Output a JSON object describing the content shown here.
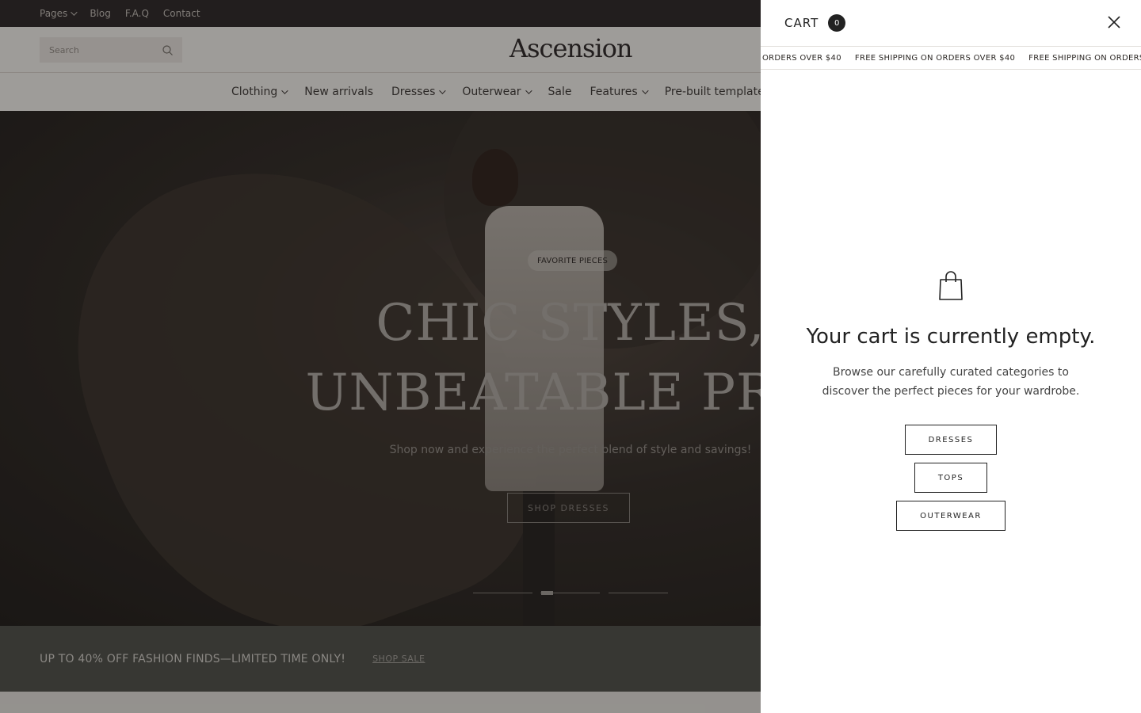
{
  "topbar": {
    "links": [
      "Pages",
      "Blog",
      "F.A.Q",
      "Contact"
    ]
  },
  "header": {
    "search_placeholder": "Search",
    "logo": "Ascension"
  },
  "nav": {
    "items": [
      {
        "label": "Clothing",
        "has_dropdown": true
      },
      {
        "label": "New arrivals",
        "has_dropdown": false
      },
      {
        "label": "Dresses",
        "has_dropdown": true
      },
      {
        "label": "Outerwear",
        "has_dropdown": true
      },
      {
        "label": "Sale",
        "has_dropdown": false
      },
      {
        "label": "Features",
        "has_dropdown": true
      },
      {
        "label": "Pre-built template",
        "has_dropdown": false
      }
    ]
  },
  "hero": {
    "badge": "FAVORITE PIECES",
    "title_line1": "CHIC STYLES,",
    "title_line2": "UNBEATABLE PRIC",
    "subtitle": "Shop now and experience the perfect blend of style and savings!",
    "cta": "SHOP DRESSES"
  },
  "promo": {
    "text": "UP TO 40% OFF FASHION FINDS—LIMITED TIME ONLY!",
    "link": "SHOP SALE"
  },
  "cart": {
    "title": "CART",
    "count": "0",
    "marquee": [
      "ORDERS OVER $40",
      "FREE SHIPPING ON ORDERS OVER $40",
      "FREE SHIPPING ON ORDERS OV"
    ],
    "empty_title": "Your cart is currently empty.",
    "empty_desc": "Browse our carefully curated categories to discover the perfect pieces for your wardrobe.",
    "categories": [
      "DRESSES",
      "TOPS",
      "OUTERWEAR"
    ]
  },
  "colors": {
    "topbar_bg": "#2a2625",
    "promo_bg": "#4a4c46",
    "accent": "#222222"
  },
  "icons": {
    "search": "search-icon",
    "close": "close-icon",
    "bag": "shopping-bag-icon",
    "chevron": "chevron-down-icon"
  }
}
